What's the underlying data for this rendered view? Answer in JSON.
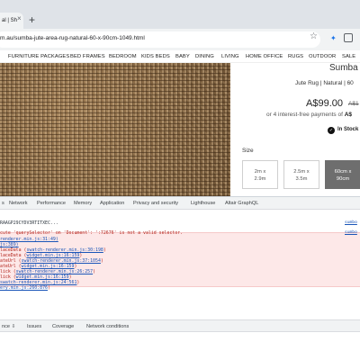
{
  "browser": {
    "tab_title": "al | Sh",
    "new_tab_glyph": "+",
    "close_glyph": "×",
    "url": "m.au/sumba-jute-area-rug-natural-60-x-90cm-1049.html",
    "star_glyph": "☆",
    "ext1_glyph": "✦"
  },
  "site_nav": {
    "items": [
      "FURNITURE PACKAGES",
      "BED FRAMES",
      "BEDROOM",
      "KIDS BEDS",
      "BABY",
      "DINING",
      "LIVING",
      "HOME OFFICE",
      "RUGS",
      "OUTDOOR",
      "SALE"
    ]
  },
  "product": {
    "title": "Sumba",
    "subtitle": "Jute Rug | Natural | 60",
    "price": "A$99.00",
    "old_price": "A$1",
    "afterpay_prefix": "or 4 interest-free payments of ",
    "afterpay_amount": "A$",
    "stock_glyph": "✓",
    "stock_label": "In Stock",
    "size_label": "Size",
    "sizes": [
      {
        "line1": "2m x",
        "line2": "2.9m"
      },
      {
        "line1": "2.5m x",
        "line2": "3.5m"
      },
      {
        "line1": "60cm x",
        "line2": "90cm"
      }
    ],
    "selected_size_index": 2
  },
  "devtools": {
    "tabs": [
      "s",
      "Network",
      "Performance",
      "Memory",
      "Application",
      "Privacy and security",
      "Lighthouse",
      "Altair GraphQL"
    ],
    "console_lines": [
      {
        "text": "RAAGP29CYDV3RTITXEC...",
        "source": "sumbo"
      },
      {
        "text": "cute 'querySelector' on 'Document': ':72676' is not a valid selector.",
        "source": "sumbo",
        "error": true
      },
      {
        "text": "renderer.min.js:31:49)",
        "link": true
      },
      {
        "text": "js:389)",
        "link": true
      },
      {
        "text": "lace",
        "mid": "Data (",
        "link_text": "swatch-renderer.min.js:30:198",
        "tail": ")"
      },
      {
        "text": "lace",
        "mid": "Data (",
        "link_text": "widget.min.js:16:159",
        "tail": ")"
      },
      {
        "text": "ateUrl (",
        "mid": "",
        "link_text": "swatch-renderer.min.js:37:1054",
        "tail": ")"
      },
      {
        "text": "ateUrl (",
        "mid": "",
        "link_text": "widget.min.js:16:159",
        "tail": ")"
      },
      {
        "text": "lick (",
        "mid": "",
        "link_text": "swatch-renderer.min.js:26:257",
        "tail": ")"
      },
      {
        "text": "lick (",
        "mid": "",
        "link_text": "widget.min.js:16:159",
        "tail": ")"
      },
      {
        "text": "",
        "mid": "",
        "link_text": "swatch-renderer.min.js:24:561",
        "tail": ")"
      },
      {
        "text": "",
        "mid": "",
        "link_text": "ery.min.js:260:876",
        "tail": ")"
      }
    ],
    "drawer_tabs": [
      "nce ⇩",
      "Issues",
      "Coverage",
      "Network conditions"
    ]
  }
}
